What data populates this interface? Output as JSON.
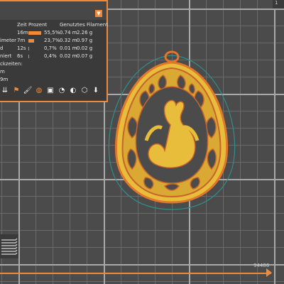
{
  "stats": {
    "header": {
      "time": "Zeit",
      "percent": "Prozent",
      "filament": "Genutztes Filament"
    },
    "rows": [
      {
        "feature": "",
        "time": "16m",
        "percent": "55,5%",
        "meters": "0.74 m",
        "grams": "2.26 g",
        "share": 0.555
      },
      {
        "feature": "imeter",
        "time": "7m",
        "percent": "23,7%",
        "meters": "0.32 m",
        "grams": "0.97 g",
        "share": 0.237
      },
      {
        "feature": "d",
        "time": "12s",
        "percent": "0,7%",
        "meters": "0.01 m",
        "grams": "0.02 g",
        "share": 0.007
      },
      {
        "feature": "niert",
        "time": "6s",
        "percent": "0,4%",
        "meters": "0.02 m",
        "grams": "0.07 g",
        "share": 0.004
      }
    ],
    "section": "ckzeiten:",
    "sub1": "m",
    "sub2": "9m",
    "dropdown_icon": "chevron-down-icon"
  },
  "toolbar": {
    "icons": [
      "arrows-icon",
      "flag-icon",
      "paint-icon",
      "color-icon",
      "cube-icon",
      "pie-icon",
      "contrast-icon",
      "box-icon",
      "export-icon"
    ]
  },
  "slider": {
    "value": "94486",
    "position": 1.0
  },
  "colors": {
    "accent": "#ef8a3a",
    "model_fill": "#e8bd3c",
    "model_outline": "#e0772a",
    "brim": "#3aa0a0"
  },
  "corner_label": "1"
}
